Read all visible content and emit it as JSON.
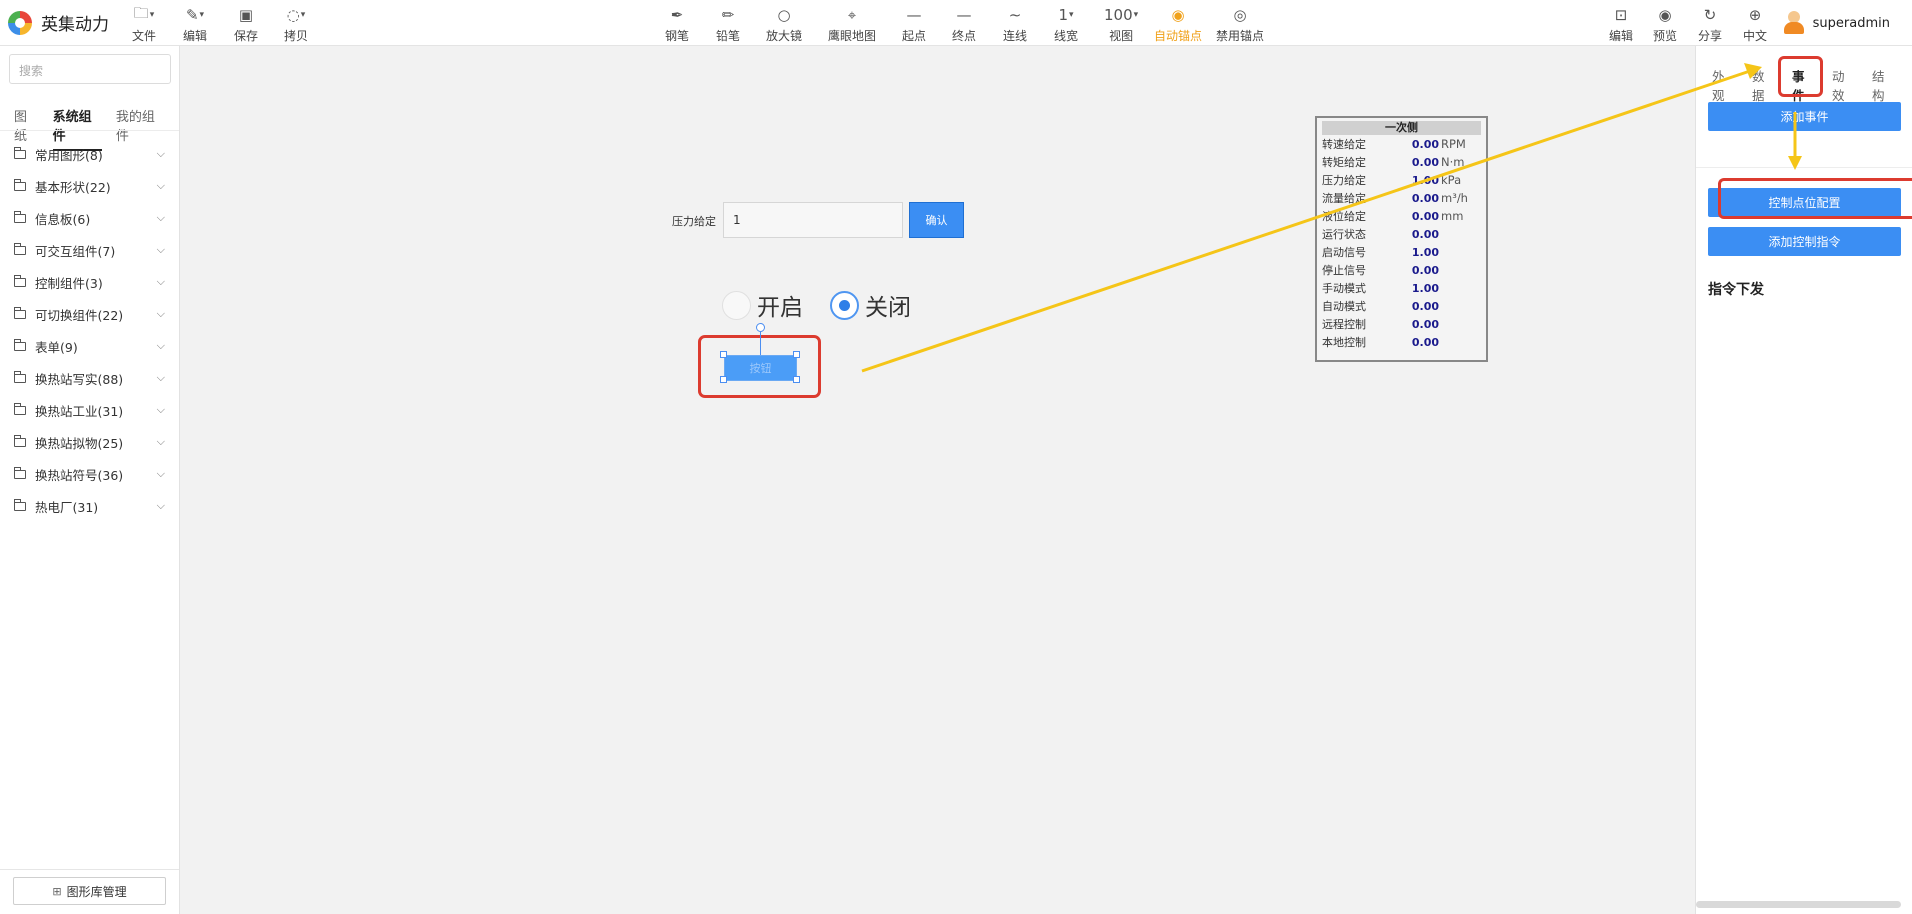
{
  "app": {
    "name": "英集动力"
  },
  "toolbar_left": [
    {
      "label": "文件",
      "icon": "file-icon"
    },
    {
      "label": "编辑",
      "icon": "edit-icon"
    },
    {
      "label": "保存",
      "icon": "save-icon"
    },
    {
      "label": "拷贝",
      "icon": "copy-icon"
    }
  ],
  "toolbar_center": [
    {
      "label": "钢笔",
      "icon": "pen-icon"
    },
    {
      "label": "铅笔",
      "icon": "pencil-icon"
    },
    {
      "label": "放大镜",
      "icon": "magnifier-icon"
    },
    {
      "label": "鹰眼地图",
      "icon": "map-pin-icon"
    },
    {
      "label": "起点",
      "icon": "line-start-icon"
    },
    {
      "label": "终点",
      "icon": "line-end-icon"
    },
    {
      "label": "连线",
      "icon": "curve-icon"
    },
    {
      "label": "线宽",
      "value": "1"
    },
    {
      "label": "视图",
      "value": "100"
    },
    {
      "label": "自动锚点",
      "icon": "anchor-auto-icon",
      "active": true
    },
    {
      "label": "禁用锚点",
      "icon": "anchor-disable-icon"
    }
  ],
  "toolbar_right": [
    {
      "label": "编辑",
      "icon": "edit-doc-icon"
    },
    {
      "label": "预览",
      "icon": "eye-icon"
    },
    {
      "label": "分享",
      "icon": "share-icon"
    },
    {
      "label": "中文",
      "icon": "globe-icon"
    }
  ],
  "user": {
    "name": "superadmin"
  },
  "left_panel": {
    "search_placeholder": "搜索",
    "tabs": [
      "图纸",
      "系统组件",
      "我的组件"
    ],
    "active_tab": "系统组件",
    "categories": [
      "常用图形(8)",
      "基本形状(22)",
      "信息板(6)",
      "可交互组件(7)",
      "控制组件(3)",
      "可切换组件(22)",
      "表单(9)",
      "换热站写实(88)",
      "换热站工业(31)",
      "换热站拟物(25)",
      "换热站符号(36)",
      "热电厂(31)"
    ],
    "library_button": "图形库管理"
  },
  "canvas": {
    "pressure_label": "压力给定",
    "pressure_value": "1",
    "confirm_label": "确认",
    "radio_on": "开启",
    "radio_off": "关闭",
    "radio_selected": "关闭",
    "button_label": "按钮",
    "info_board": {
      "title": "一次侧",
      "rows": [
        {
          "label": "转速给定",
          "value": "0.00",
          "unit": "RPM"
        },
        {
          "label": "转矩给定",
          "value": "0.00",
          "unit": "N·m"
        },
        {
          "label": "压力给定",
          "value": "1.00",
          "unit": "kPa"
        },
        {
          "label": "流量给定",
          "value": "0.00",
          "unit": "m³/h"
        },
        {
          "label": "液位给定",
          "value": "0.00",
          "unit": "mm"
        },
        {
          "label": "运行状态",
          "value": "0.00",
          "unit": ""
        },
        {
          "label": "启动信号",
          "value": "1.00",
          "unit": ""
        },
        {
          "label": "停止信号",
          "value": "0.00",
          "unit": ""
        },
        {
          "label": "手动模式",
          "value": "1.00",
          "unit": ""
        },
        {
          "label": "自动模式",
          "value": "0.00",
          "unit": ""
        },
        {
          "label": "远程控制",
          "value": "0.00",
          "unit": ""
        },
        {
          "label": "本地控制",
          "value": "0.00",
          "unit": ""
        }
      ]
    }
  },
  "right_panel": {
    "tabs": [
      "外观",
      "数据",
      "事件",
      "动效",
      "结构"
    ],
    "active_tab": "事件",
    "add_event": "添加事件",
    "control_point_config": "控制点位配置",
    "add_control_command": "添加控制指令",
    "command_heading": "指令下发"
  },
  "colors": {
    "accent_blue": "#3b8ef3",
    "annotation_red": "#dc3b2f",
    "annotation_arrow": "#f5c518",
    "active_tool": "#f0a11a"
  }
}
